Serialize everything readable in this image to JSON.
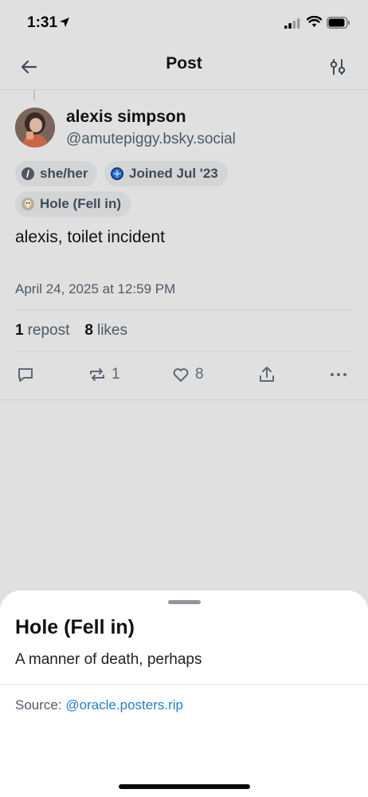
{
  "status_bar": {
    "time": "1:31"
  },
  "nav": {
    "title": "Post"
  },
  "author": {
    "display_name": "alexis simpson",
    "handle": "@amutepiggy.bsky.social"
  },
  "badges": [
    {
      "label": "she/her"
    },
    {
      "label": "Joined Jul '23"
    },
    {
      "label": "Hole (Fell in)"
    }
  ],
  "post": {
    "text": "alexis, toilet incident",
    "date": "April 24, 2025 at 12:59 PM"
  },
  "stats": {
    "reposts_count": "1",
    "reposts_label": "repost",
    "likes_count": "8",
    "likes_label": "likes"
  },
  "actions": {
    "repost_count": "1",
    "like_count": "8"
  },
  "sheet": {
    "title": "Hole (Fell in)",
    "description": "A manner of death, perhaps",
    "source_label": "Source:",
    "source_link": "@oracle.posters.rip"
  },
  "icons": {
    "back": "arrow-left-icon",
    "filter": "sliders-icon",
    "reply": "speech-bubble-icon",
    "repost": "repost-arrows-icon",
    "like": "heart-icon",
    "share": "share-upload-icon",
    "more": "ellipsis-icon"
  },
  "colors": {
    "link": "#1f7fd6",
    "background": "#e0e0e0",
    "sheet_background": "#ffffff"
  }
}
